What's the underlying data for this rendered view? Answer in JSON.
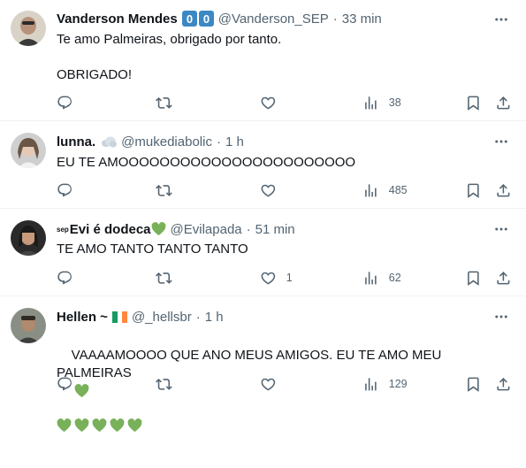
{
  "colors": {
    "text": "#0f1419",
    "secondary": "#536471",
    "divider": "#eff3f4",
    "heart_emoji": "#78b159",
    "badge_blue": "#3b88c3"
  },
  "tweets": [
    {
      "name": "Vanderson Mendes",
      "name_badges": [
        "0",
        "0"
      ],
      "handle": "@Vanderson_SEP",
      "dot": "·",
      "time": "33 min",
      "text": "Te amo Palmeiras, obrigado por tanto.\n\nOBRIGADO!",
      "likes": "",
      "views": "38",
      "icons": [
        "reply-icon",
        "retweet-icon",
        "like-icon",
        "views-icon",
        "bookmark-icon",
        "share-icon"
      ]
    },
    {
      "name": "lunna.",
      "name_emoji": "cloud-emoji",
      "handle": "@mukediabolic",
      "dot": "·",
      "time": "1 h",
      "text": "EU TE AMOOOOOOOOOOOOOOOOOOOOOOO",
      "likes": "",
      "views": "485"
    },
    {
      "name_prefix": "sep",
      "name": "Evi é dodeca",
      "name_emoji": "green-heart-emoji",
      "handle": "@Evilapada",
      "dot": "·",
      "time": "51 min",
      "text": "TE AMO TANTO TANTO TANTO",
      "likes": "1",
      "views": "62"
    },
    {
      "name": "Hellen ~",
      "name_emoji": "ireland-flag-emoji",
      "handle": "@_hellsbr",
      "dot": "·",
      "time": "1 h",
      "text": "VAAAAMOOOO QUE ANO MEUS AMIGOS. EU TE AMO MEU PALMEIRAS",
      "trailing_emoji": "green-heart-emoji",
      "second_line_emoji_count": 5,
      "likes": "",
      "views": "129"
    }
  ]
}
